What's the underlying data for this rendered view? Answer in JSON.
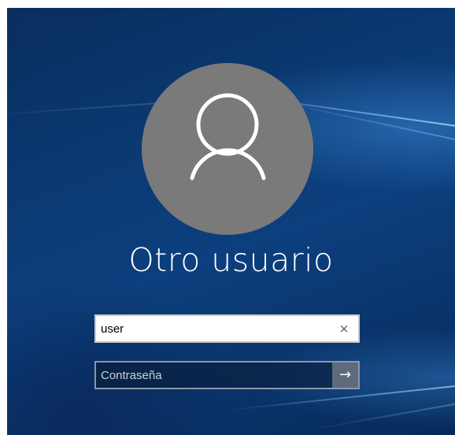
{
  "login": {
    "display_name": "Otro usuario",
    "username_value": "user",
    "clear_label": "×",
    "password_placeholder": "Contraseña",
    "submit_label": "→"
  },
  "icons": {
    "avatar": "user-silhouette-icon",
    "clear": "clear-icon",
    "submit": "arrow-right-icon"
  },
  "colors": {
    "avatar_bg": "#7a7a7a",
    "background": "#0b3a74",
    "submit_bg": "#5d6b7c"
  }
}
